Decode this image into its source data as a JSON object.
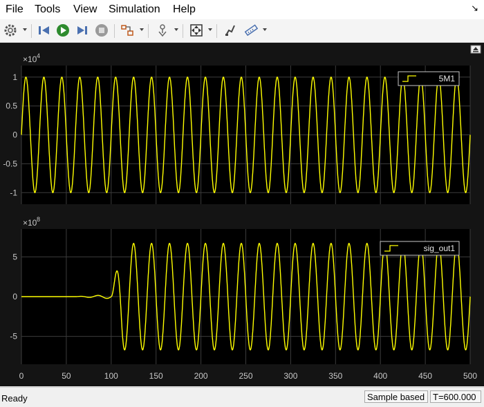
{
  "menu": [
    "File",
    "Tools",
    "View",
    "Simulation",
    "Help"
  ],
  "toolbar_icons": [
    "settings-gear-icon",
    "step-back-icon",
    "run-icon",
    "step-forward-icon",
    "stop-icon",
    "signal-tracing-icon",
    "triggers-icon",
    "zoom-fit-icon",
    "style-icon",
    "measurements-icon"
  ],
  "colors": {
    "signal": "#ffff00",
    "plot_bg": "#000000",
    "window_bg": "#141414",
    "grid": "#3c3c3c",
    "axis_text": "#c8c8c8"
  },
  "status": {
    "left": "Ready",
    "sample_based": "Sample based",
    "time": "T=600.000"
  },
  "chart_data": [
    {
      "type": "line",
      "exponent_label": "×10",
      "exponent_power": "4",
      "ylim": [
        -1.2,
        1.2
      ],
      "yticks": [
        -1,
        -0.5,
        0,
        0.5,
        1
      ],
      "ytick_labels": [
        "-1",
        "-0.5",
        "0",
        "0.5",
        "1"
      ],
      "xlim": [
        0,
        500
      ],
      "grid": true,
      "legend_position": "top-right",
      "series": [
        {
          "name": "5M1",
          "amplitude": 1,
          "period": 20,
          "onset": 0
        }
      ]
    },
    {
      "type": "line",
      "exponent_label": "×10",
      "exponent_power": "8",
      "ylim": [
        -8.5,
        8.5
      ],
      "yticks": [
        -5,
        0,
        5
      ],
      "ytick_labels": [
        "-5",
        "0",
        "5"
      ],
      "xlim": [
        0,
        500
      ],
      "xticks": [
        0,
        50,
        100,
        150,
        200,
        250,
        300,
        350,
        400,
        450,
        500
      ],
      "xtick_labels": [
        "0",
        "50",
        "100",
        "150",
        "200",
        "250",
        "300",
        "350",
        "400",
        "450",
        "500"
      ],
      "grid": true,
      "legend_position": "top-right",
      "series": [
        {
          "name": "sig_out1",
          "amplitude": 6.7,
          "period": 20,
          "onset": 100
        }
      ]
    }
  ]
}
